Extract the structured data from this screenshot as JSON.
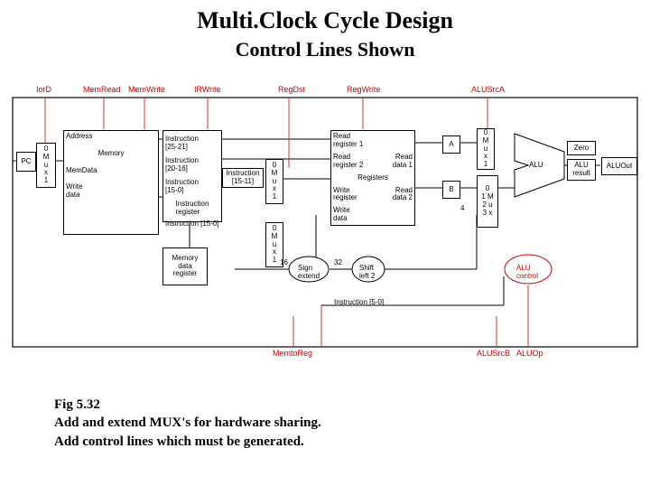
{
  "title": "Multi.Clock Cycle Design",
  "subtitle": "Control Lines Shown",
  "control_labels": {
    "iord": "IorD",
    "memread": "MemRead",
    "memwrite": "MemWrite",
    "irwrite": "IRWrite",
    "regdst": "RegDst",
    "regwrite": "RegWrite",
    "alusrca": "ALUSrcA",
    "memtoreg": "MemtoReg",
    "alusrcb": "ALUSrcB",
    "aluop": "ALUOp"
  },
  "blocks": {
    "pc": "PC",
    "address": "Address",
    "memory": "Memory",
    "memdata": "MemData",
    "writedata": "Write\ndata",
    "ir": "Instruction\nregister",
    "mdr": "Memory\ndata\nregister",
    "instr2521": "Instruction\n[25-21]",
    "instr2016": "Instruction\n[20-16]",
    "instr150a": "Instruction\n[15-0]",
    "instr1511": "Instruction\n[15-11]",
    "instr150b": "Instruction [15-0]",
    "instr50": "Instruction [5-0]",
    "mux0": "0\nM\nu\nx\n1",
    "mux01232": "0\n1 M\n2 u\n3 x",
    "readreg1": "Read\nregister 1",
    "readreg2": "Read\nregister 2",
    "registers": "Registers",
    "writereg": "Write\nregister",
    "writedata2": "Write\ndata",
    "readdata1": "Read\ndata 1",
    "readdata2": "Read\ndata 2",
    "a": "A",
    "b": "B",
    "signext": "Sign\nextend",
    "shl2": "Shift\nleft 2",
    "alu": "ALU",
    "zero": "Zero",
    "aluresult": "ALU\nresult",
    "aluout": "ALUOut",
    "aluctrl": "ALU\ncontrol",
    "n16": "16",
    "n32": "32",
    "n4": "4"
  },
  "caption": {
    "line1": "Fig 5.32",
    "line2": "Add and extend MUX's for hardware sharing.",
    "line3": "Add control lines which must be generated."
  }
}
